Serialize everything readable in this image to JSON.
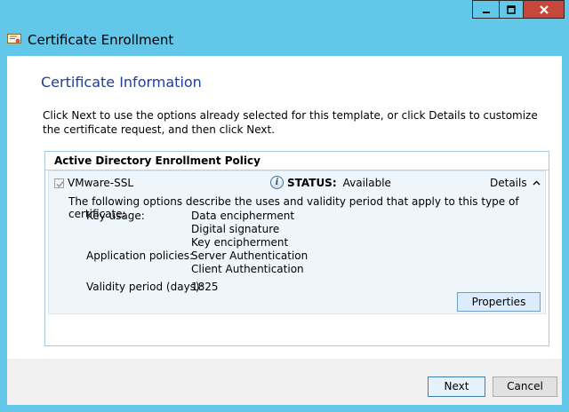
{
  "window": {
    "title": "Certificate Enrollment",
    "caption_buttons": {
      "minimize": "minimize-icon",
      "maximize": "maximize-icon",
      "close": "close-icon"
    }
  },
  "page": {
    "heading": "Certificate Information",
    "intro": "Click Next to use the options already selected for this template, or click Details to customize the certificate request, and then click Next."
  },
  "policy": {
    "header": "Active Directory Enrollment Policy",
    "item": {
      "name": "VMware-SSL",
      "checked": true,
      "status_label": "STATUS:",
      "status_value": "Available",
      "details_label": "Details",
      "description": "The following options describe the uses and validity period that apply to this type of certificate:",
      "key_usage_label": "Key usage:",
      "key_usage": [
        "Data encipherment",
        "Digital signature",
        "Key encipherment"
      ],
      "app_policies_label": "Application policies:",
      "app_policies": [
        "Server Authentication",
        "Client Authentication"
      ],
      "validity_label": "Validity period (days):",
      "validity_value": "1825",
      "properties_label": "Properties"
    }
  },
  "footer": {
    "next_label": "Next",
    "cancel_label": "Cancel"
  },
  "colors": {
    "frame": "#63c7ea",
    "heading": "#1e3f9a",
    "close_button": "#c7473a"
  }
}
